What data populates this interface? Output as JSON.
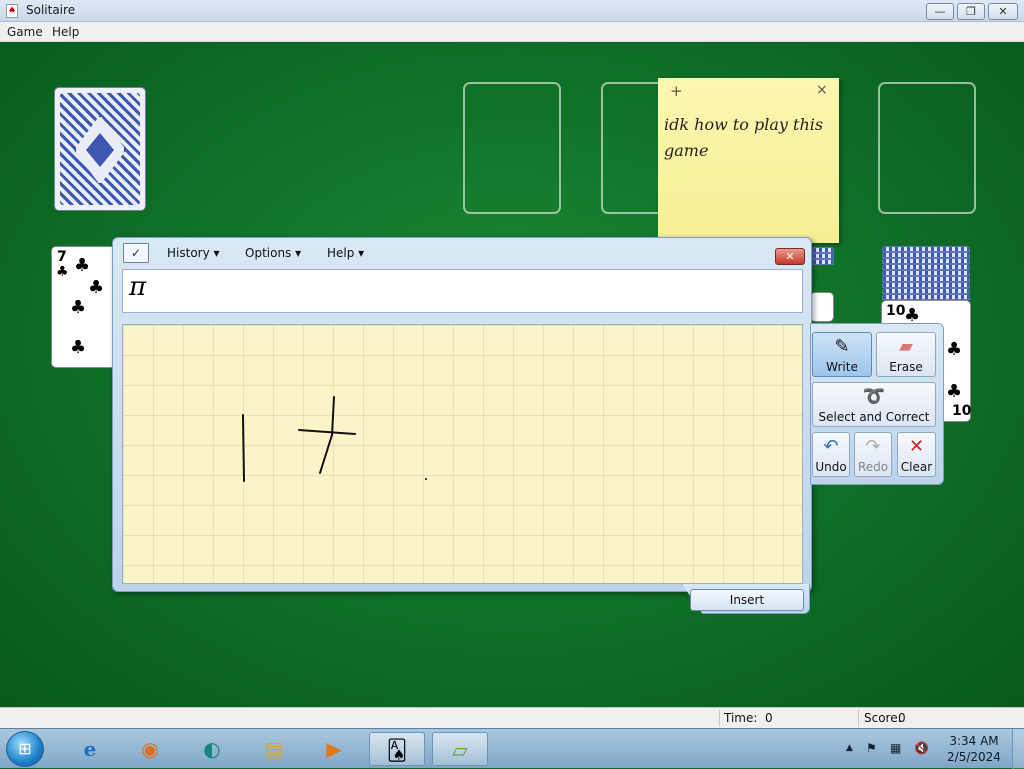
{
  "window": {
    "title": "Solitaire",
    "controls": {
      "minimize": "—",
      "restore": "❐",
      "close": "✕"
    }
  },
  "menu": {
    "items": [
      "Game",
      "Help"
    ]
  },
  "game": {
    "tableau_left_card": {
      "rank": "7",
      "suit": "♣"
    },
    "tableau_right_card": {
      "rank": "10",
      "rank_bottom": "10",
      "suit": "♣"
    }
  },
  "sticky_note": {
    "add_symbol": "+",
    "close_symbol": "×",
    "text": "idk how to play this game"
  },
  "input_panel": {
    "menu": [
      "History ▾",
      "Options ▾",
      "Help ▾"
    ],
    "close_symbol": "✕",
    "recognized_text": "π",
    "insert_label": "Insert"
  },
  "tools": {
    "write": {
      "label": "Write",
      "icon": "pen-icon",
      "glyph": "✎"
    },
    "erase": {
      "label": "Erase",
      "icon": "eraser-icon",
      "glyph": "▰"
    },
    "select": {
      "label": "Select and Correct",
      "icon": "lasso-icon",
      "glyph": "➰"
    },
    "undo": {
      "label": "Undo",
      "icon": "undo-icon",
      "glyph": "↶"
    },
    "redo": {
      "label": "Redo",
      "icon": "redo-icon",
      "glyph": "↷"
    },
    "clear": {
      "label": "Clear",
      "icon": "clear-icon",
      "glyph": "✕"
    }
  },
  "status": {
    "time_label": "Time:",
    "time_value": "0",
    "score_label": "Score:",
    "score_value": "0"
  },
  "taskbar": {
    "start_glyph": "⊞",
    "apps": [
      {
        "name": "internet-explorer",
        "glyph": "e"
      },
      {
        "name": "firefox",
        "glyph": "◉"
      },
      {
        "name": "browser-app",
        "glyph": "◐"
      },
      {
        "name": "file-explorer",
        "glyph": "▤"
      },
      {
        "name": "media-player",
        "glyph": "▶"
      },
      {
        "name": "solitaire",
        "glyph": "🂡"
      },
      {
        "name": "sticky-notes",
        "glyph": "▱"
      }
    ],
    "tray": {
      "arrow": "▲",
      "flag": "⚑",
      "network": "▦",
      "volume": "🔇"
    },
    "clock": {
      "time": "3:34 AM",
      "date": "2/5/2024"
    }
  },
  "colors": {
    "felt": "#0f6e27",
    "note": "#f7ee94",
    "pad": "#fbf4c8",
    "panel": "#bcd3ea"
  }
}
